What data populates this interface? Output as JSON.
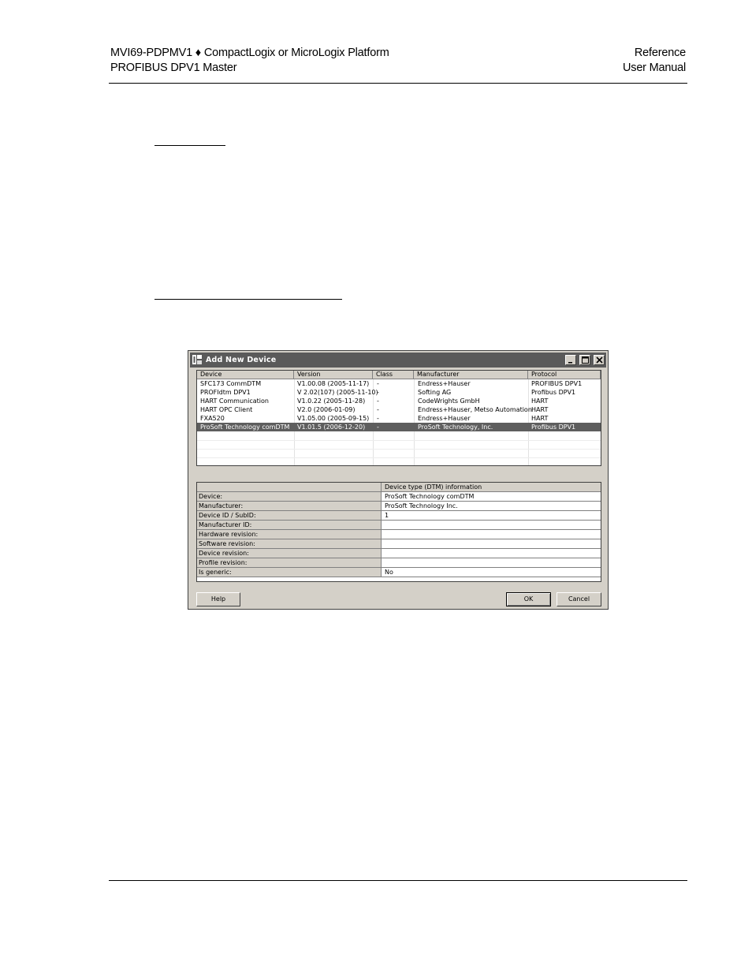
{
  "header": {
    "left_line1": "MVI69-PDPMV1 ♦ CompactLogix or MicroLogix Platform",
    "left_line2": "PROFIBUS DPV1 Master",
    "right_line1": "Reference",
    "right_line2": "User Manual"
  },
  "dialog": {
    "title": "Add New Device",
    "columns": [
      "Device",
      "Version",
      "Class",
      "Manufacturer",
      "Protocol"
    ],
    "rows": [
      [
        "SFC173 CommDTM",
        "V1.00.08 (2005-11-17)",
        "-",
        "Endress+Hauser",
        "PROFIBUS DPV1"
      ],
      [
        "PROFIdtm DPV1",
        "V 2.02(107) (2005-11-10)",
        "-",
        "Softing AG",
        "Profibus DPV1"
      ],
      [
        "HART Communication",
        "V1.0.22 (2005-11-28)",
        "-",
        "CodeWrights GmbH",
        "HART"
      ],
      [
        "HART OPC Client",
        "V2.0 (2006-01-09)",
        "-",
        "Endress+Hauser, Metso Automation",
        "HART"
      ],
      [
        "FXA520",
        "V1.05.00 (2005-09-15)",
        "-",
        "Endress+Hauser",
        "HART"
      ],
      [
        "ProSoft Technology comDTM",
        "V1.01.5 (2006-12-20)",
        "-",
        "ProSoft Technology, Inc.",
        "Profibus DPV1"
      ]
    ],
    "selected_row": 5,
    "info_header": "Device type (DTM) information",
    "info": [
      {
        "label": "Device:",
        "value": "ProSoft Technology comDTM"
      },
      {
        "label": "Manufacturer:",
        "value": "ProSoft Technology Inc."
      },
      {
        "label": "Device ID / SubID:",
        "value": "1"
      },
      {
        "label": "Manufacturer ID:",
        "value": ""
      },
      {
        "label": "Hardware revision:",
        "value": ""
      },
      {
        "label": "Software revision:",
        "value": ""
      },
      {
        "label": "Device revision:",
        "value": ""
      },
      {
        "label": "Profile revision:",
        "value": ""
      },
      {
        "label": "Is generic:",
        "value": "No"
      }
    ],
    "buttons": {
      "help": "Help",
      "ok": "OK",
      "cancel": "Cancel"
    }
  },
  "colors": {
    "titlebar": "#5a5a5a",
    "dialog_bg": "#d4d0c8",
    "selection": "#5e5e5e"
  }
}
